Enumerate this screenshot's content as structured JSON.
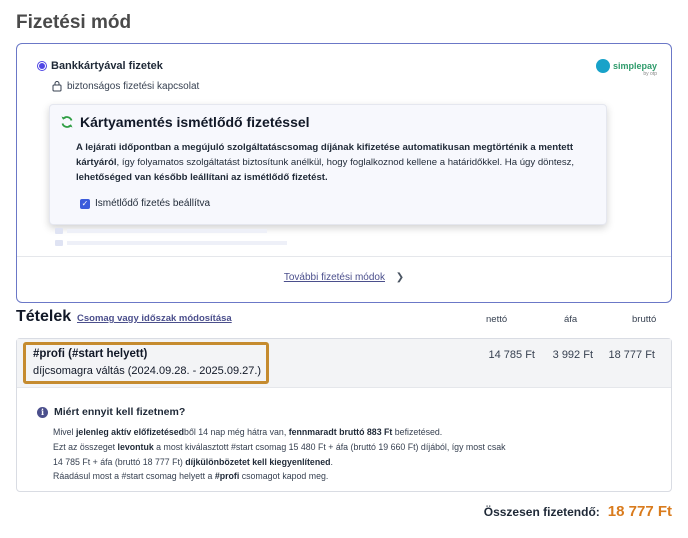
{
  "page_title": "Fizetési mód",
  "payment": {
    "method_label": "Bankkártyával fizetek",
    "secure_label": "biztonságos fizetési kapcsolat",
    "logo_text": "simplepay",
    "logo_sub": "by otp",
    "recurring": {
      "title": "Kártyamentés ismétlődő fizetéssel",
      "p1_b1": "A lejárati időpontban a megújuló szolgáltatáscsomag díjának kifizetése automatikusan megtörténik a mentett kártyáról",
      "p1_t1": ", így folyamatos szolgáltatást biztosítunk anélkül, hogy foglalkoznod kellene a határidőkkel. Ha úgy döntesz, ",
      "p1_b2": "lehetőséged van később leállítani az ismétlődő fizetést.",
      "checkbox_label": "Ismétlődő fizetés beállítva"
    },
    "more_methods_label": "További fizetési módok"
  },
  "items": {
    "title": "Tételek",
    "modify_link": "Csomag vagy időszak módosítása",
    "col_net": "nettó",
    "col_vat": "áfa",
    "col_gross": "bruttó",
    "rows": [
      {
        "name": "#profi (#start helyett)",
        "desc": "díjcsomagra váltás (2024.09.28. - 2025.09.27.)",
        "net": "14 785 Ft",
        "vat": "3 992 Ft",
        "gross": "18 777 Ft"
      }
    ],
    "why": {
      "title": "Miért ennyit kell fizetnem?",
      "l1_a": "Mivel ",
      "l1_b": "jelenleg aktív előfizetésed",
      "l1_c": "ből 14 nap még hátra van, ",
      "l1_d": "fennmaradt bruttó 883 Ft",
      "l1_e": " befizetésed.",
      "l2_a": "Ezt az összeget ",
      "l2_b": "levontuk",
      "l2_c": " a most kiválasztott #start csomag 15 480 Ft + áfa (bruttó 19 660 Ft) díjából, így most csak",
      "l3_a": "14 785 Ft + áfa (bruttó 18 777 Ft) ",
      "l3_b": "díjkülönbözetet kell kiegyenlítened",
      "l3_c": ".",
      "l4_a": "Ráadásul most a #start csomag helyett a ",
      "l4_b": "#profi",
      "l4_c": " csomagot kapod meg."
    }
  },
  "total": {
    "label": "Összesen fizetendő:",
    "value": "18 777 Ft"
  },
  "colors": {
    "accent": "#4f46e5",
    "highlight_border": "#c58b2f",
    "total_value": "#d97b1d",
    "link": "#4b4f8c"
  }
}
